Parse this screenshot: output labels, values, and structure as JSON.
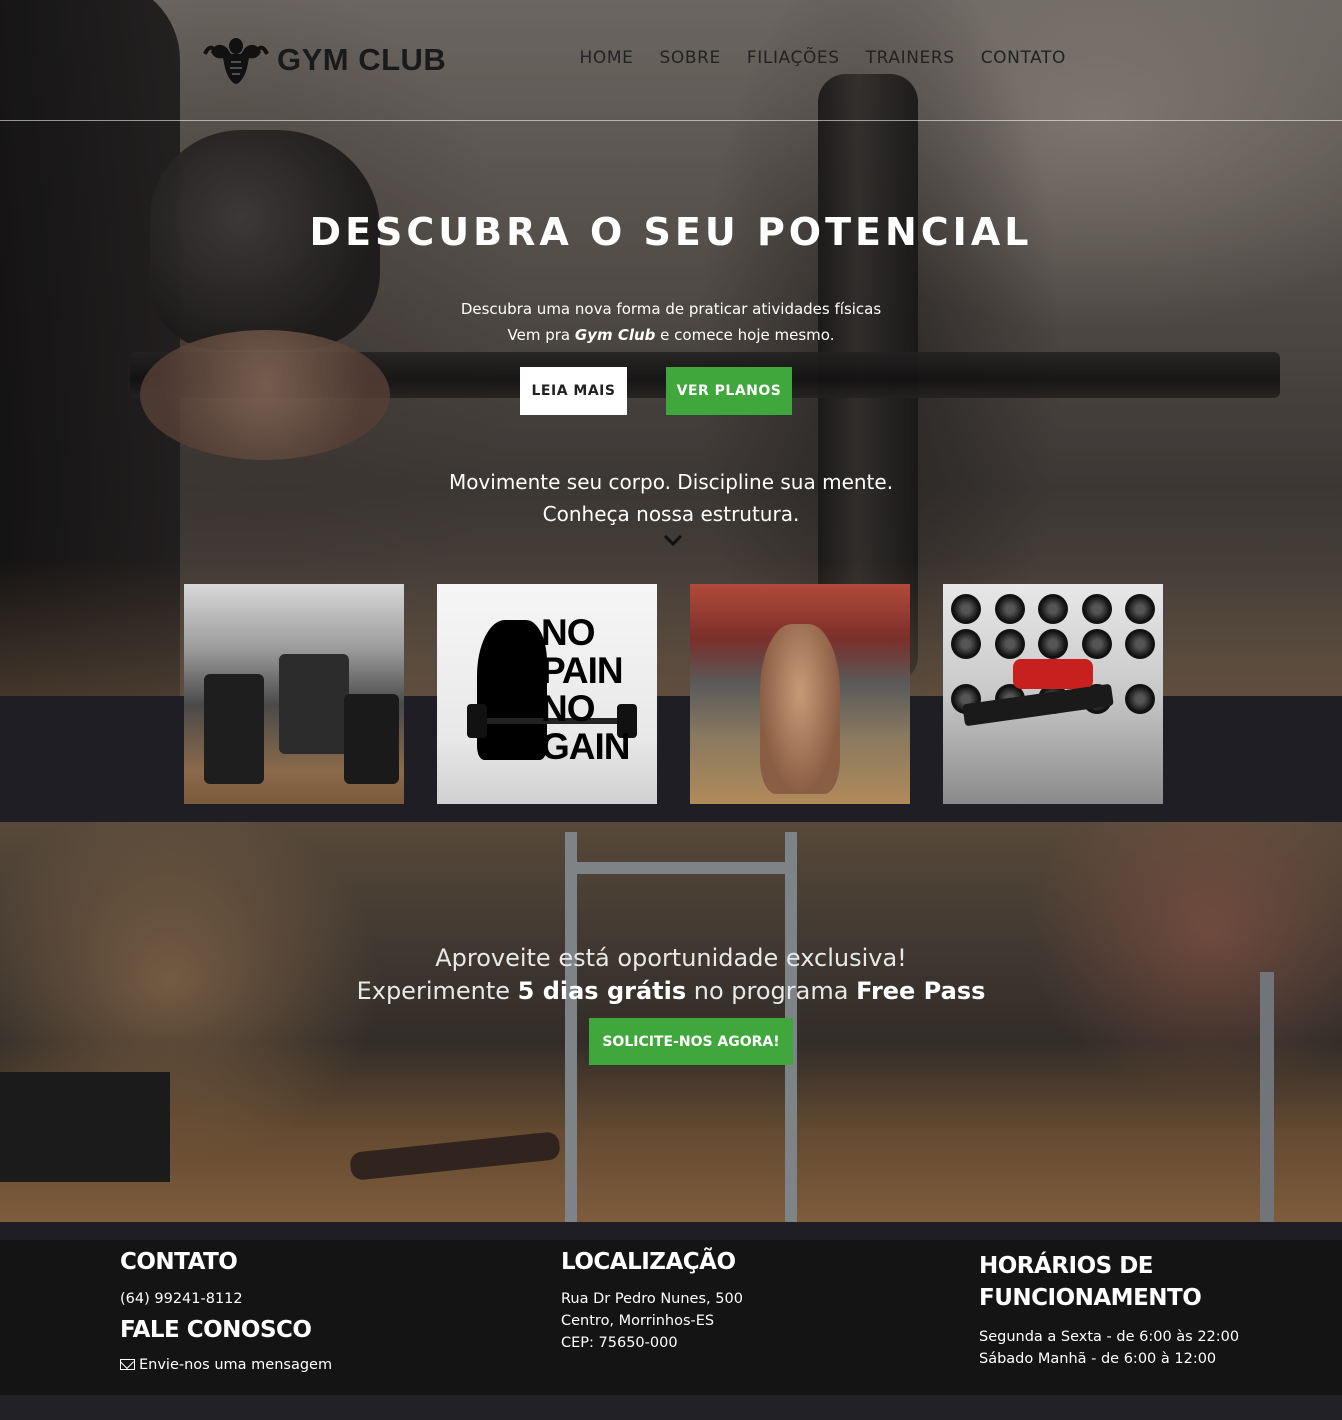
{
  "nav": {
    "logo_text": "GYM CLUB",
    "menu": [
      "HOME",
      "SOBRE",
      "FILIAÇÕES",
      "TRAINERS",
      "CONTATO"
    ]
  },
  "hero": {
    "title": "DESCUBRA O SEU POTENCIAL",
    "sub_line1": "Descubra uma nova forma de praticar atividades físicas",
    "sub_line2_pre": "Vem pra ",
    "sub_line2_brand": "Gym Club",
    "sub_line2_post": " e comece hoje mesmo.",
    "btn_read_more": "LEIA MAIS",
    "btn_plans": "VER PLANOS",
    "tagline1": "Movimente seu corpo. Discipline sua mente.",
    "tagline2": "Conheça nossa estrutura."
  },
  "gallery": {
    "poster_text": [
      "NO",
      "PAIN",
      "NO",
      "GAIN"
    ]
  },
  "promo": {
    "line1": "Aproveite está oportunidade exclusiva!",
    "line2_pre": "Experimente ",
    "line2_bold": "5 dias grátis",
    "line2_mid": " no programa ",
    "line2_bold2": "Free Pass",
    "button": "SOLICITE-NOS AGORA!"
  },
  "footer": {
    "contact_title": "CONTATO",
    "phone": "(64) 99241-8112",
    "talk_title": "FALE CONOSCO",
    "message_link": "Envie-nos uma mensagem",
    "location_title": "LOCALIZAÇÃO",
    "address1": "Rua Dr Pedro Nunes, 500",
    "address2": "Centro, Morrinhos-ES",
    "address3": "CEP: 75650-000",
    "hours_title1": "HORÁRIOS DE",
    "hours_title2": "FUNCIONAMENTO",
    "hours1": "Segunda a Sexta - de 6:00 às 22:00",
    "hours2": "Sábado Manhã - de 6:00 à 12:00"
  },
  "colors": {
    "accent_green": "#3fa73c",
    "dark_band": "#1f1e24",
    "footer_bg": "#141414"
  }
}
